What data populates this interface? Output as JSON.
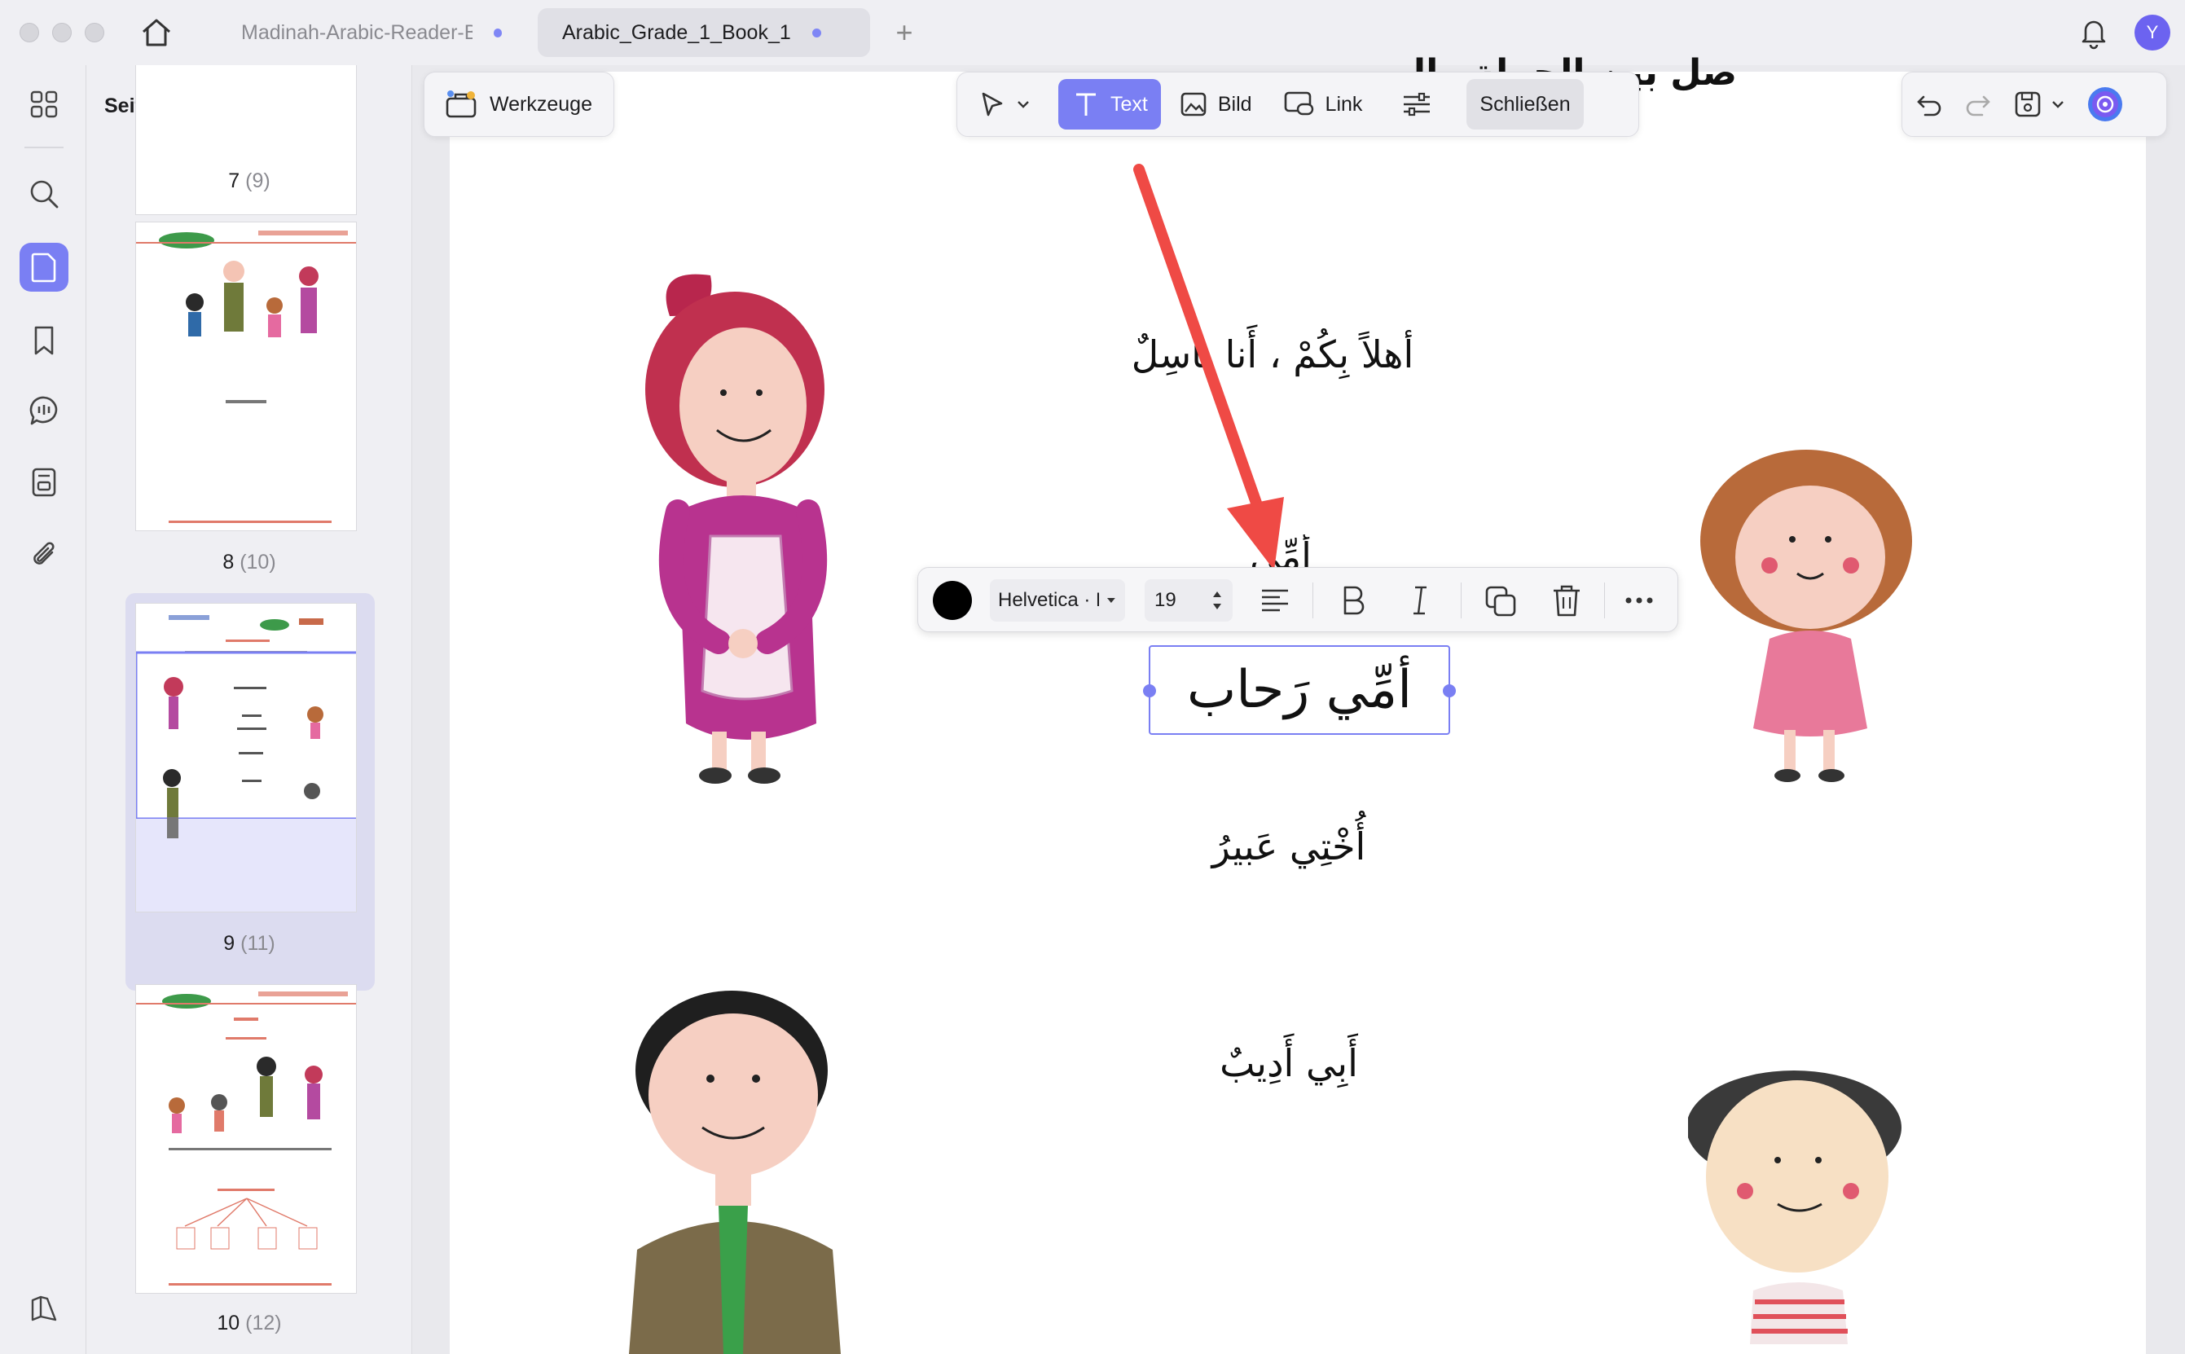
{
  "tabs": [
    {
      "label": "Madinah-Arabic-Reader-B",
      "active": false
    },
    {
      "label": "Arabic_Grade_1_Book_1",
      "active": true
    }
  ],
  "user": {
    "initial": "Y"
  },
  "panel": {
    "title": "Seitenminiaturen",
    "thumbnails": [
      {
        "page": "7",
        "label": "(9)"
      },
      {
        "page": "8",
        "label": "(10)"
      },
      {
        "page": "9",
        "label": "(11)",
        "selected": true
      },
      {
        "page": "10",
        "label": "(12)"
      }
    ]
  },
  "toolbar": {
    "tools_label": "Werkzeuge",
    "text_label": "Text",
    "image_label": "Bild",
    "link_label": "Link",
    "close_label": "Schließen"
  },
  "format_bar": {
    "font": "Helvetica · F",
    "size": "19",
    "color": "#000000"
  },
  "document": {
    "header_text": "صل بين الجملةِ وال",
    "lines": [
      "أهلاً بِكُمْ ، أَنا باسِلٌ",
      "أُمِّي",
      "أمِّي رَحاب",
      "أُخْتِي عَبيرُ",
      "أَبِي أَدِيبٌ"
    ]
  },
  "colors": {
    "accent": "#7a7ff3",
    "arrow": "#ef4a45"
  }
}
